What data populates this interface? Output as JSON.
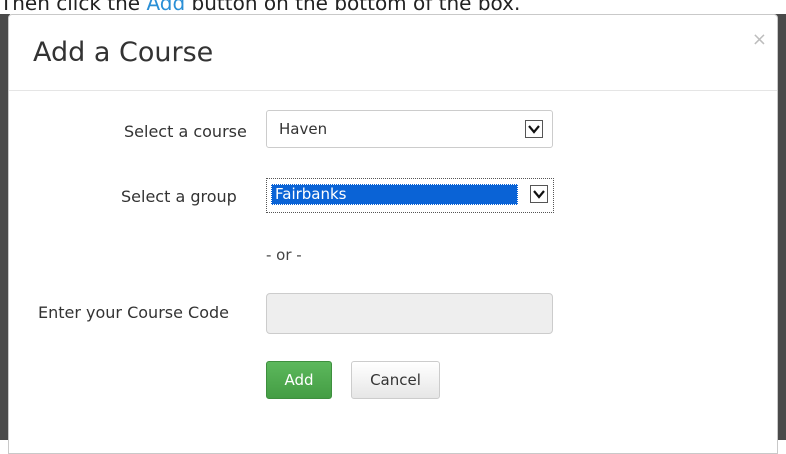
{
  "instruction": {
    "prefix": "Then click the ",
    "link": "Add",
    "suffix": " button on the bottom of the box."
  },
  "modal": {
    "title": "Add a Course",
    "close_symbol": "×"
  },
  "form": {
    "course_label": "Select a course",
    "course_value": "Haven",
    "group_label": "Select a group",
    "group_value": "Fairbanks",
    "or_text": "- or -",
    "code_label": "Enter your Course Code",
    "code_value": "",
    "code_placeholder": ""
  },
  "buttons": {
    "add_label": "Add",
    "cancel_label": "Cancel"
  },
  "icons": {
    "close": "close-icon",
    "dropdown": "chevron-down-icon"
  },
  "colors": {
    "add_button": "#5cb85c",
    "selection_highlight": "#0a63d6",
    "link": "#2a8fd6"
  }
}
